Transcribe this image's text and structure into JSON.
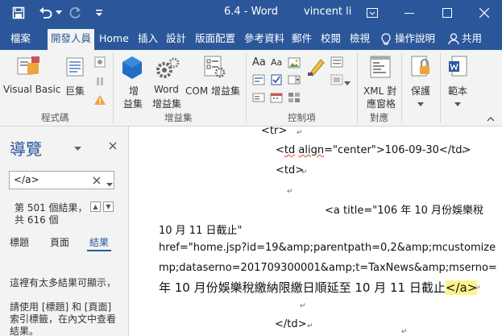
{
  "window": {
    "doc_title": "6.4  -  Word",
    "user": "vincent li"
  },
  "tabs": [
    {
      "label": "檔案"
    },
    {
      "label": "開發人員"
    },
    {
      "label": "Home"
    },
    {
      "label": "插入"
    },
    {
      "label": "設計"
    },
    {
      "label": "版面配置"
    },
    {
      "label": "參考資料"
    },
    {
      "label": "郵件"
    },
    {
      "label": "校閱"
    },
    {
      "label": "檢視"
    },
    {
      "label": "操作說明"
    },
    {
      "label": "共用"
    }
  ],
  "ribbon": {
    "code": {
      "visual_basic": "Visual Basic",
      "macros": "巨集",
      "group": "程式碼"
    },
    "addins": {
      "addins_line1": "增",
      "addins_line2": "益集",
      "word_addins_line1": "Word",
      "word_addins_line2": "增益集",
      "com_addins": "COM 增益集",
      "group": "增益集"
    },
    "controls": {
      "aa_big": "Aa",
      "aa_small": "Aa",
      "group": "控制項"
    },
    "mapping": {
      "xml_line1": "XML 對",
      "xml_line2": "應窗格",
      "group": "對應"
    },
    "protect": {
      "label": "保護"
    },
    "templates": {
      "label": "範本"
    }
  },
  "nav": {
    "title": "導覽",
    "search_value": "</a>",
    "result_line1": "第 501 個結果，",
    "result_line2": "共 616 個",
    "tab_headings": "標題",
    "tab_pages": "頁面",
    "tab_results": "結果",
    "msg1": "這裡有太多結果可顯示，",
    "msg2": "請使用 [標題] 和 [頁面]",
    "msg3": "索引標籤，在內文中查看",
    "msg4": "結果。"
  },
  "doc": {
    "l1": "<tr>",
    "l2_pre": "<",
    "l2_td": "td",
    "l2_sp": " ",
    "l2_align": "align",
    "l2_post": "=\"center\">106-09-30</td>",
    "l3": "<td>",
    "l5": "<a title=\"106 年 10 月份娛樂稅",
    "l6": "10 月 11 日截止\"",
    "l7": "href=\"home.jsp?id=19&amp;parentpath=0,2&amp;mcustomize",
    "l8": "mp;dataserno=201709300001&amp;t=TaxNews&amp;mserno=",
    "l9_text": "年 10 月份娛樂稅繳納限繳日順延至 10 月 11 日截止",
    "l9_hl": "</a>",
    "l11": "</td>"
  },
  "colors": {
    "word_blue": "#2b579a",
    "ribbon_bg": "#f3f3f3",
    "highlight": "#fff38a"
  }
}
